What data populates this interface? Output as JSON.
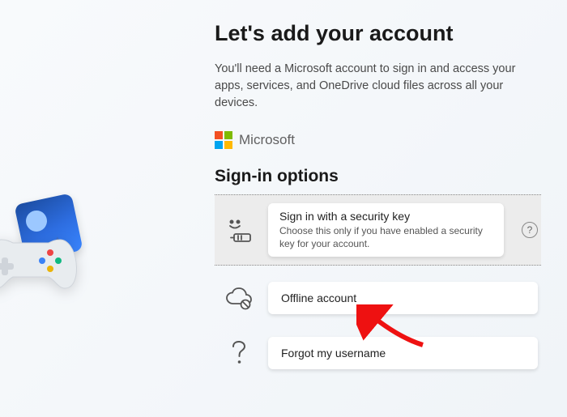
{
  "title": "Let's add your account",
  "subtitle": "You'll need a Microsoft account to sign in and access your apps, services, and OneDrive cloud files across all your devices.",
  "brand": "Microsoft",
  "sectionHeading": "Sign-in options",
  "options": [
    {
      "title": "Sign in with a security key",
      "desc": "Choose this only if you have enabled a security key for your account."
    },
    {
      "title": "Offline account"
    },
    {
      "title": "Forgot my username"
    }
  ],
  "helpGlyph": "?"
}
